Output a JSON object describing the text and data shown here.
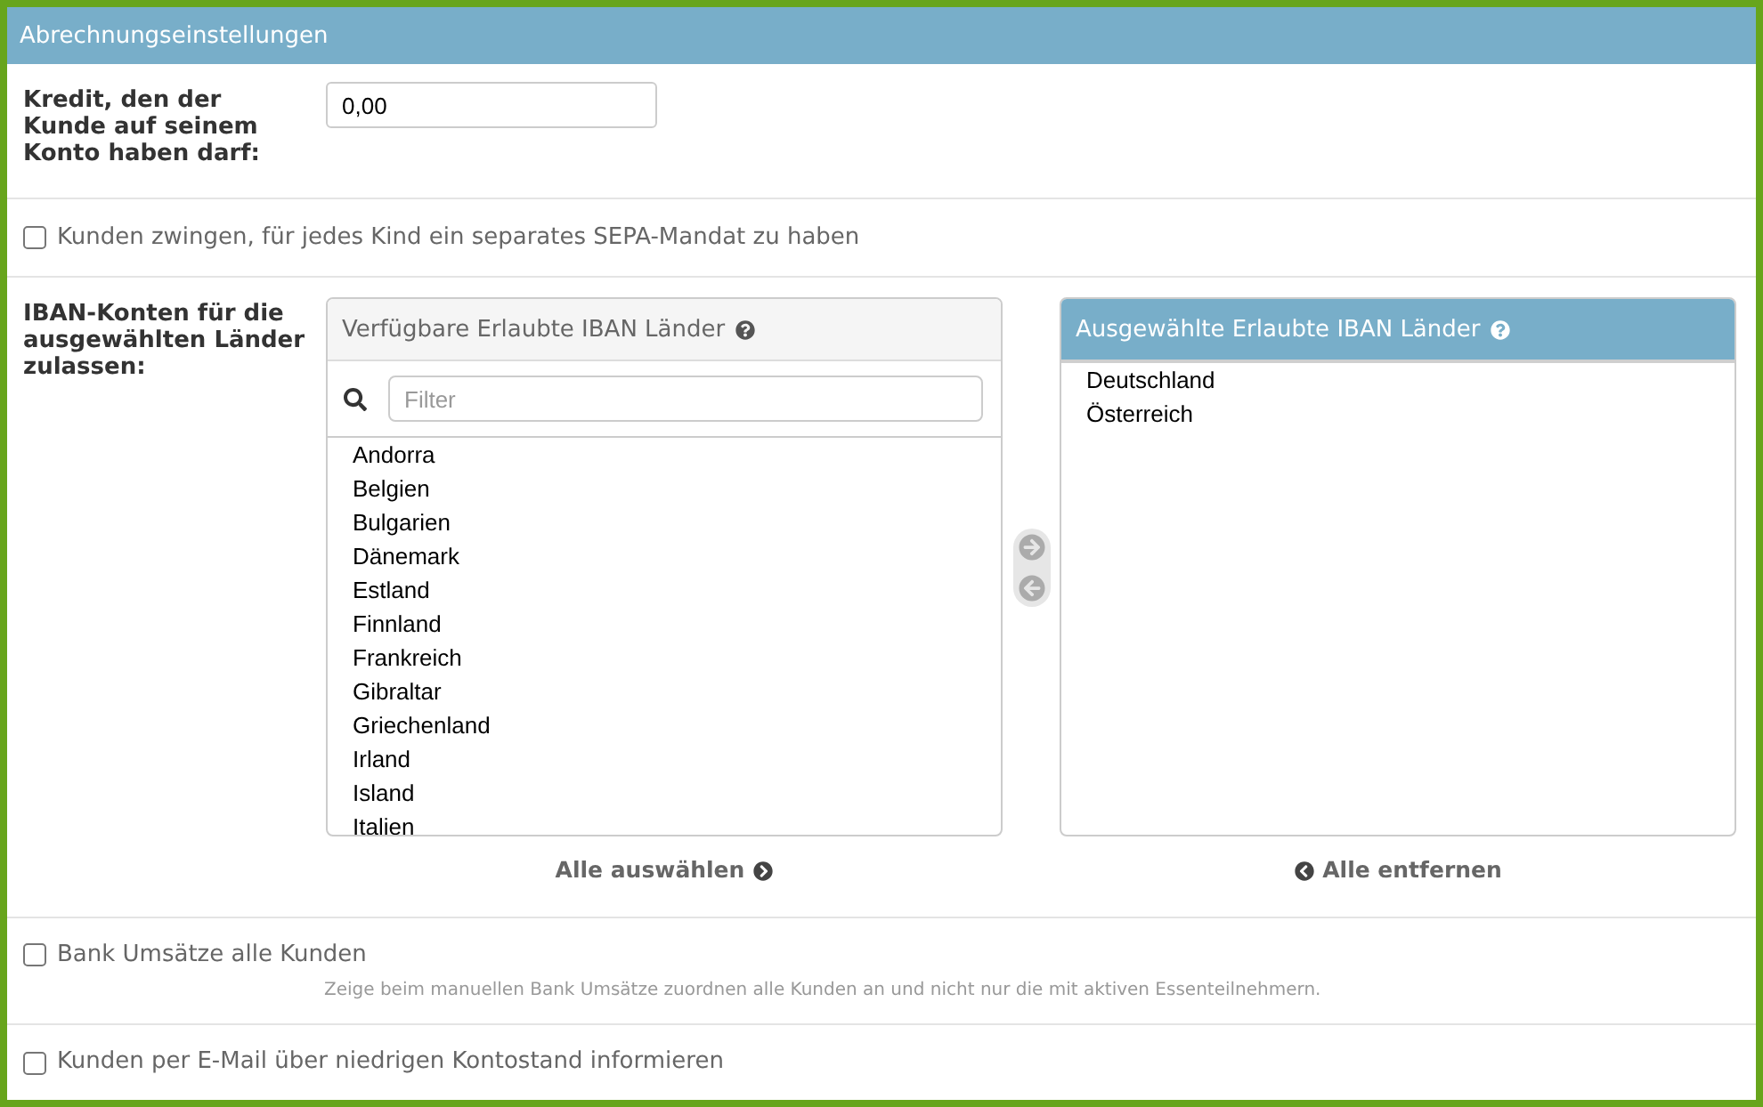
{
  "panel": {
    "title": "Abrechnungseinstellungen"
  },
  "fields": [
    {
      "kind": "text_input",
      "label": "Kredit, den der Kunde auf seinem Konto haben darf:",
      "value": "0,00"
    },
    {
      "kind": "checkbox",
      "label": "Kunden zwingen, für jedes Kind ein separates SEPA-Mandat zu haben",
      "checked": false
    },
    {
      "kind": "dual_list",
      "label": "IBAN-Konten für die ausgewählten Länder zulassen:",
      "available": {
        "title": "Verfügbare Erlaubte IBAN Länder",
        "filter_placeholder": "Filter",
        "items": [
          {
            "label": "Andorra",
            "selected": false
          },
          {
            "label": "Belgien",
            "selected": false
          },
          {
            "label": "Bulgarien",
            "selected": false
          },
          {
            "label": "Dänemark",
            "selected": false
          },
          {
            "label": "Estland",
            "selected": false
          },
          {
            "label": "Finnland",
            "selected": false
          },
          {
            "label": "Frankreich",
            "selected": false
          },
          {
            "label": "Gibraltar",
            "selected": false
          },
          {
            "label": "Griechenland",
            "selected": false
          },
          {
            "label": "Irland",
            "selected": false
          },
          {
            "label": "Island",
            "selected": false
          },
          {
            "label": "Italien",
            "selected": false
          }
        ]
      },
      "move_buttons": [
        {
          "kind": "move_right",
          "disabled": true
        },
        {
          "kind": "move_left",
          "disabled": true
        }
      ],
      "chosen": {
        "title": "Ausgewählte Erlaubte IBAN Länder",
        "items": [
          {
            "label": "Deutschland",
            "selected": false
          },
          {
            "label": "Österreich",
            "selected": false
          }
        ]
      },
      "select_all": "Alle auswählen",
      "remove_all": "Alle entfernen"
    },
    {
      "kind": "checkbox",
      "label": "Bank Umsätze alle Kunden",
      "checked": false,
      "help": "Zeige beim manuellen Bank Umsätze zuordnen alle Kunden an und nicht nur die mit aktiven Essenteilnehmern."
    },
    {
      "kind": "checkbox",
      "label": "Kunden per E-Mail über niedrigen Kontostand informieren",
      "checked": false
    }
  ]
}
